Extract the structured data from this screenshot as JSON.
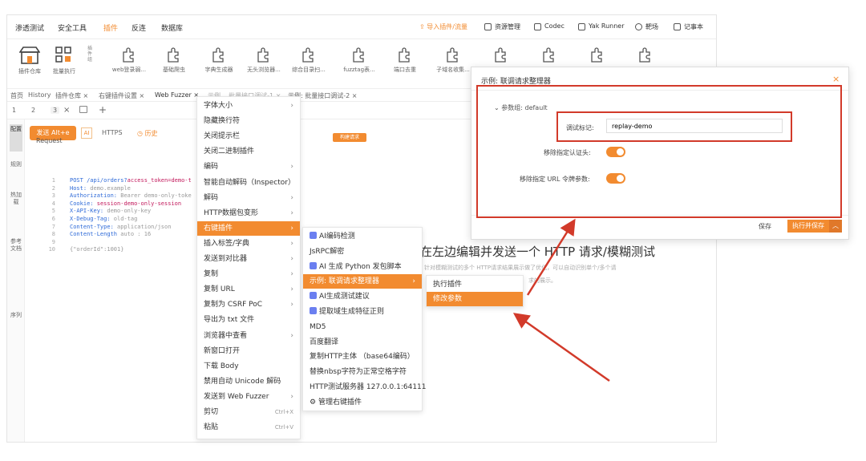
{
  "topnav": {
    "items": [
      "渗透测试",
      "安全工具",
      "插件",
      "反连",
      "数据库"
    ],
    "active_index": 2,
    "import_link": "导入插件/流量",
    "buttons": [
      "资源管理",
      "Codec",
      "Yak Runner",
      "靶场",
      "记事本"
    ]
  },
  "toolbar": {
    "store_label": "插件仓库",
    "batch_label": "批量执行",
    "side_label": "插件组",
    "plugins": [
      "web登录弱...",
      "基础爬虫",
      "字典生成器",
      "无头浏览器...",
      "综合目录扫...",
      "fuzztag表...",
      " 端口去重",
      "子域名收集...",
      "",
      "",
      "",
      ""
    ]
  },
  "tabs": {
    "items": [
      "首页",
      "History",
      "插件仓库 ×",
      "右键插件设置 ×",
      "Web Fuzzer ×",
      "示例... 批量接口调试-1 ×",
      "示例: 批量接口调试-2 ×"
    ],
    "active_index": 4,
    "sub": [
      "1",
      "2",
      "3"
    ]
  },
  "sidebar": [
    "配置",
    "规则",
    "热加载",
    "参考文档",
    "序列"
  ],
  "reqbar": {
    "send": "发送 Alt+e",
    "https": "HTTPS",
    "history": "历史",
    "pane_title": "Request",
    "fuzz_btn": "构建请求"
  },
  "code": [
    {
      "n": "1",
      "k": "POST /api/orders?",
      "v": "",
      "p": "access_token=demo-t"
    },
    {
      "n": "2",
      "k": "Host:",
      "v": " demo.example",
      "p": ""
    },
    {
      "n": "3",
      "k": "Authorization:",
      "v": " Bearer demo-only-toke",
      "p": ""
    },
    {
      "n": "4",
      "k": "Cookie:",
      "v": "",
      "p": " session-demo-only-session"
    },
    {
      "n": "5",
      "k": "X-API-Key:",
      "v": " demo-only-key",
      "p": ""
    },
    {
      "n": "6",
      "k": "X-Debug-Tag:",
      "v": " old-tag",
      "p": ""
    },
    {
      "n": "7",
      "k": "Content-Type:",
      "v": " application/json",
      "p": ""
    },
    {
      "n": "8",
      "k": "Content-Length",
      "v": " auto : 16",
      "p": ""
    },
    {
      "n": "9",
      "k": "",
      "v": "",
      "p": ""
    },
    {
      "n": "10",
      "k": "",
      "v": "{\"orderId\":1001}",
      "p": ""
    }
  ],
  "context_menu": [
    {
      "label": "字体大小",
      "arrow": true
    },
    {
      "label": "隐藏换行符",
      "arrow": false
    },
    {
      "label": "关闭提示栏",
      "arrow": false
    },
    {
      "label": "关闭二进制插件",
      "arrow": false
    },
    {
      "label": "编码",
      "arrow": true
    },
    {
      "label": "智能自动解码（Inspector）",
      "arrow": false
    },
    {
      "label": "解码",
      "arrow": true
    },
    {
      "label": "HTTP数据包变形",
      "arrow": true
    },
    {
      "label": "右键插件",
      "arrow": true,
      "hl": true
    },
    {
      "label": "插入标签/字典",
      "arrow": true
    },
    {
      "label": "发送到对比器",
      "arrow": true
    },
    {
      "label": "复制",
      "arrow": true
    },
    {
      "label": "复制 URL",
      "arrow": true
    },
    {
      "label": "复制为 CSRF PoC",
      "arrow": true
    },
    {
      "label": "导出为 txt 文件",
      "arrow": false
    },
    {
      "label": "浏览器中查看",
      "arrow": true
    },
    {
      "label": "新窗口打开",
      "arrow": false
    },
    {
      "label": "下载 Body",
      "arrow": false
    },
    {
      "label": "禁用自动 Unicode 解码",
      "arrow": false
    },
    {
      "label": "发送到 Web Fuzzer",
      "arrow": true
    },
    {
      "label": "剪切",
      "shortcut": "Ctrl+X"
    },
    {
      "label": "粘贴",
      "shortcut": "Ctrl+V"
    }
  ],
  "submenu": [
    {
      "label": "AI编码检测",
      "ai": true
    },
    {
      "label": "JsRPC解密"
    },
    {
      "label": "AI 生成 Python 发包脚本",
      "ai": true
    },
    {
      "label": "示例: 联调请求整理器",
      "hl": true,
      "arrow": true
    },
    {
      "label": "AI生成测试建议",
      "ai": true
    },
    {
      "label": "提取域生成特征正则",
      "ai": true
    },
    {
      "label": "MD5"
    },
    {
      "label": "百度翻译"
    },
    {
      "label": "复制HTTP主体 （base64编码）"
    },
    {
      "label": "替换nbsp字符为正常空格字符"
    },
    {
      "label": "HTTP测试服务器 127.0.0.1:64111"
    },
    {
      "label": "管理右键插件",
      "gear": true
    }
  ],
  "submenu2": [
    {
      "label": "执行插件"
    },
    {
      "label": "修改参数",
      "hl": true
    }
  ],
  "hint": {
    "title": "在左边编辑并发送一个 HTTP 请求/模糊测试",
    "sub1": "针对模糊测试的多个 HTTP请求结果展示做了优化，可以自动识别单个/多个请",
    "sub2": "求的展示。"
  },
  "dialog": {
    "title": "示例: 联调请求整理器",
    "close": "×",
    "param_group": "参数组: default",
    "debug_label": "调试标记:",
    "debug_value": "replay-demo",
    "row2_label": "移除指定认证头:",
    "row3_label": "移除指定 URL 令牌参数:",
    "save_btn": "保存",
    "run_btn": "执行并保存"
  },
  "colors": {
    "accent": "#f28b30",
    "annotation": "#d23a2a"
  }
}
